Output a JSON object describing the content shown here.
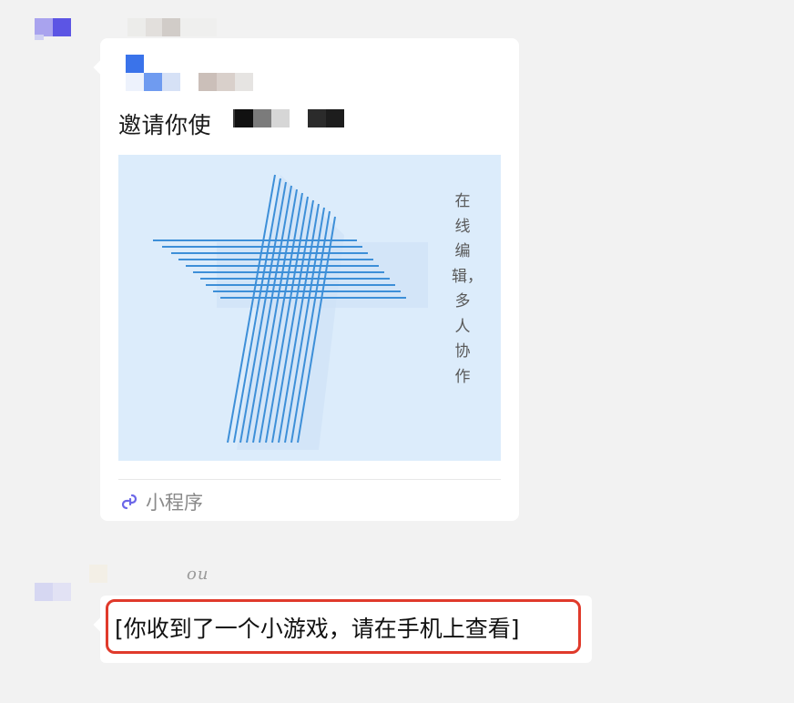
{
  "chat": {
    "messages": [
      {
        "type": "mini_program_card",
        "title_visible": "邀请你使",
        "image_vertical_text": "在线编辑，多人协作",
        "footer_label": "小程序",
        "footer_icon": "link-icon"
      },
      {
        "type": "text",
        "sender_snippet": "ou",
        "text": "[你收到了一个小游戏，请在手机上查看]",
        "highlight_color": "#e03a2b"
      }
    ]
  },
  "colors": {
    "background": "#f2f2f2",
    "bubble": "#ffffff",
    "image_bg": "#dcecfb",
    "logo_stripes": "#3d8fd8",
    "highlight": "#e03a2b"
  }
}
